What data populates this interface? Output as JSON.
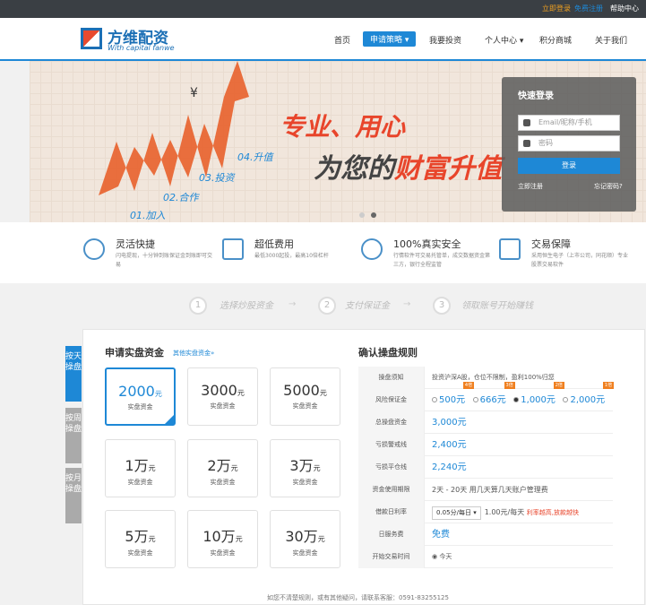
{
  "topbar": {
    "login": "立即登录",
    "register": "免费注册",
    "help": "帮助中心"
  },
  "brand": {
    "name_cn": "方维配资",
    "name_en": "With capital fanwe"
  },
  "nav": [
    "首页",
    "申请策略",
    "我要投资",
    "个人中心",
    "积分商城",
    "关于我们"
  ],
  "banner": {
    "slogan1": "专业、用心",
    "slogan2a": "为您的",
    "slogan2b": "财富升值",
    "steps": [
      "01.加入",
      "02.合作",
      "03.投资",
      "04.升值"
    ]
  },
  "login": {
    "title": "快速登录",
    "user_placeholder": "Email/昵称/手机",
    "pwd_placeholder": "密码",
    "button": "登录",
    "register": "立即注册",
    "forgot": "忘记密码?"
  },
  "features": [
    {
      "title": "灵活快捷",
      "desc": "闪电提现，十分钟到账保证金到账即可交易"
    },
    {
      "title": "超低费用",
      "desc": "最低3000起投，最高10倍杠杆"
    },
    {
      "title": "100%真实安全",
      "desc": "行情软件可交易托管单，成交数据资金第三方，银行全程监管"
    },
    {
      "title": "交易保障",
      "desc": "采用恒生电子（上市公司，同花顺）专业股票交易软件"
    }
  ],
  "steps": [
    "选择炒股资金",
    "支付保证金",
    "领取账号开始赚钱"
  ],
  "sidetabs": [
    "按天操盘",
    "按周操盘",
    "按月操盘"
  ],
  "left": {
    "title": "申请实盘资金",
    "link": "其他实盘资金»",
    "cards": [
      {
        "amount": "2000",
        "unit": "元",
        "sub": "实盘资金"
      },
      {
        "amount": "3000",
        "unit": "元",
        "sub": "实盘资金"
      },
      {
        "amount": "5000",
        "unit": "元",
        "sub": "实盘资金"
      },
      {
        "amount": "1万",
        "unit": "元",
        "sub": "实盘资金"
      },
      {
        "amount": "2万",
        "unit": "元",
        "sub": "实盘资金"
      },
      {
        "amount": "3万",
        "unit": "元",
        "sub": "实盘资金"
      },
      {
        "amount": "5万",
        "unit": "元",
        "sub": "实盘资金"
      },
      {
        "amount": "10万",
        "unit": "元",
        "sub": "实盘资金"
      },
      {
        "amount": "30万",
        "unit": "元",
        "sub": "实盘资金"
      }
    ]
  },
  "right": {
    "title": "确认操盘规则",
    "rows": [
      {
        "label": "操盘须知",
        "value": "投资沪深A股，仓位不限制，盈利100%归您"
      },
      {
        "label": "风险保证金",
        "value": ""
      },
      {
        "label": "总操盘资金",
        "value": "3,000元"
      },
      {
        "label": "亏损警戒线",
        "value": "2,400元"
      },
      {
        "label": "亏损平仓线",
        "value": "2,240元"
      },
      {
        "label": "资金使用期限",
        "value": "2天 - 20天 用几天算几天账户管理费"
      },
      {
        "label": "借款日利率",
        "value": ""
      },
      {
        "label": "日服务费",
        "value": "免费"
      },
      {
        "label": "开始交易时间",
        "value": "今天"
      }
    ],
    "deposit": [
      {
        "v": "500元",
        "tag": "4倍"
      },
      {
        "v": "666元",
        "tag": "3倍"
      },
      {
        "v": "1,000元",
        "tag": "2倍"
      },
      {
        "v": "2,000元",
        "tag": "1倍"
      }
    ],
    "rate": {
      "select": "0.05分/每日",
      "value": "1.00元/每天",
      "note": "利率越高,放款越快"
    }
  },
  "footer": "如您不清楚规则，或有其他疑问，请联系客服：0591-83255125"
}
